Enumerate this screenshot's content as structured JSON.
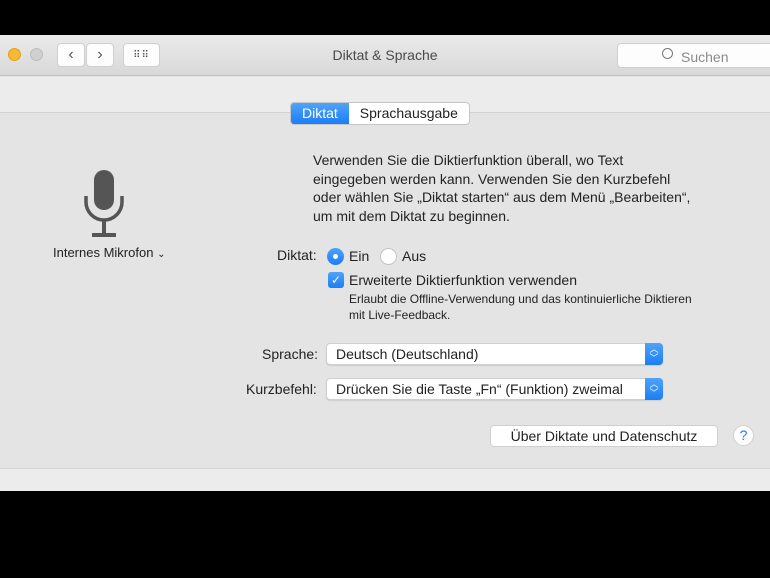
{
  "window": {
    "title": "Diktat & Sprache",
    "search_placeholder": "Suchen"
  },
  "tabs": [
    {
      "label": "Diktat",
      "active": true
    },
    {
      "label": "Sprachausgabe",
      "active": false
    }
  ],
  "mic": {
    "label": "Internes Mikrofon"
  },
  "description": [
    "Verwenden Sie die Diktierfunktion überall, wo Text",
    "eingegeben werden kann. Verwenden Sie den Kurzbefehl",
    "oder wählen Sie „Diktat starten“ aus dem Menü „Bearbeiten“,",
    "um mit dem Diktat zu beginnen."
  ],
  "dictation": {
    "label": "Diktat:",
    "on_label": "Ein",
    "off_label": "Aus",
    "selected": "Ein"
  },
  "enhanced": {
    "label": "Erweiterte Diktierfunktion verwenden",
    "checked": true,
    "note1": "Erlaubt die Offline-Verwendung und das kontinuierliche Diktieren",
    "note2": "mit Live-Feedback."
  },
  "language": {
    "label": "Sprache:",
    "value": "Deutsch (Deutschland)"
  },
  "shortcut": {
    "label": "Kurzbefehl:",
    "value": "Drücken Sie die Taste „Fn“ (Funktion) zweimal"
  },
  "privacy_button": "Über Diktate und Datenschutz",
  "help": "?",
  "colors": {
    "accent": "#1b7ef5"
  }
}
